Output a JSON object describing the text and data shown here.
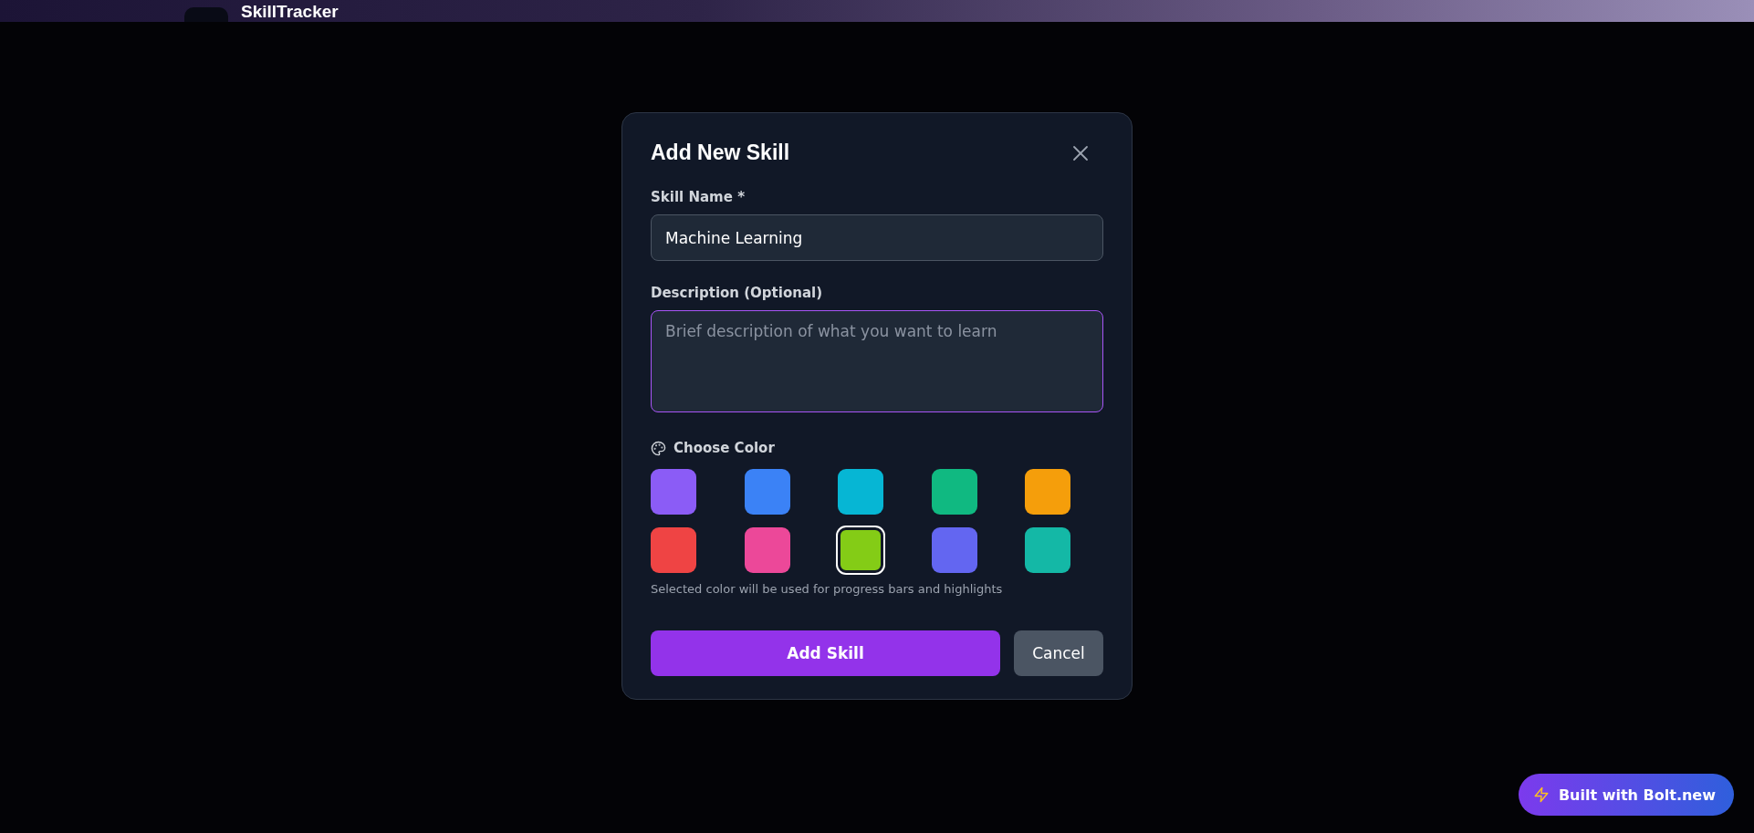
{
  "header": {
    "title": "SkillTracker"
  },
  "dialog": {
    "title": "Add New Skill",
    "name_field": {
      "label": "Skill Name *",
      "value": "Machine Learning"
    },
    "description_field": {
      "label": "Description (Optional)",
      "placeholder": "Brief description of what you want to learn",
      "focused": true
    },
    "color_picker": {
      "label": "Choose Color",
      "hint": "Selected color will be used for progress bars and highlights",
      "swatches": [
        {
          "color": "#8b5cf6",
          "selected": false
        },
        {
          "color": "#3b82f6",
          "selected": false
        },
        {
          "color": "#06b6d4",
          "selected": false
        },
        {
          "color": "#10b981",
          "selected": false
        },
        {
          "color": "#f59e0b",
          "selected": false
        },
        {
          "color": "#ef4444",
          "selected": false
        },
        {
          "color": "#ec4899",
          "selected": false
        },
        {
          "color": "#84cc16",
          "selected": true
        },
        {
          "color": "#6366f1",
          "selected": false
        },
        {
          "color": "#14b8a6",
          "selected": false
        }
      ]
    },
    "buttons": [
      {
        "kind": "primary",
        "label": "Add Skill"
      },
      {
        "kind": "secondary",
        "label": "Cancel"
      }
    ]
  },
  "badge": {
    "label": "Built with Bolt.new"
  }
}
